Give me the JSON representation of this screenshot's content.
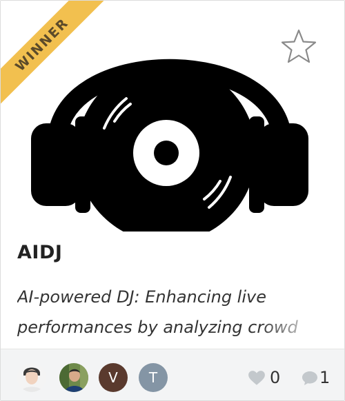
{
  "card": {
    "badge": "WINNER",
    "title": "AIDJ",
    "tagline": "AI-powered DJ: Enhancing live performances by analyzing crowd",
    "image_icon": "headphones-vinyl-icon",
    "favorite_icon": "star-outline-icon"
  },
  "footer": {
    "avatars": [
      {
        "type": "photo",
        "icon": "avatar-photo-1"
      },
      {
        "type": "photo",
        "icon": "avatar-photo-2"
      },
      {
        "type": "letter",
        "letter": "V",
        "color": "#5a3a2e"
      },
      {
        "type": "letter",
        "letter": "T",
        "color": "#8495a5"
      }
    ],
    "likes": "0",
    "comments": "1",
    "like_icon": "heart-icon",
    "comment_icon": "speech-bubble-icon"
  },
  "colors": {
    "ribbon": "#f2c04f",
    "ribbon_text": "#5b4a2a",
    "footer_bg": "#f3f4f5",
    "icon_gray": "#c3c8cc"
  }
}
